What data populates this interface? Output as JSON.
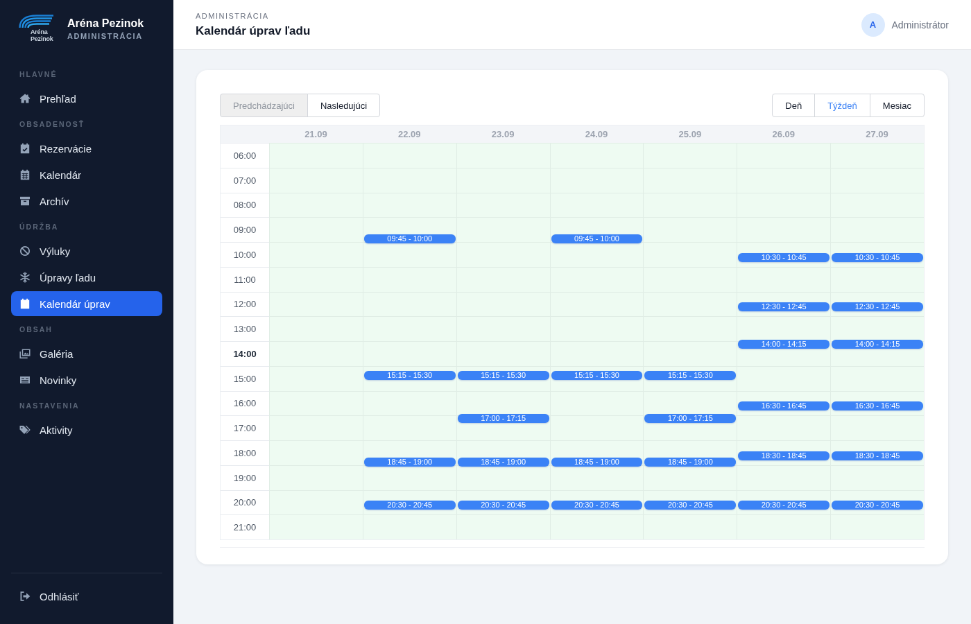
{
  "sidebar": {
    "brand": {
      "logo_text": "Aréna Pezinok",
      "name": "Aréna Pezinok",
      "subtitle": "ADMINISTRÁCIA"
    },
    "sections": [
      {
        "label": "HLAVNÉ",
        "items": [
          {
            "label": "Prehľad",
            "selected": false
          }
        ]
      },
      {
        "label": "OBSADENOSŤ",
        "items": [
          {
            "label": "Rezervácie",
            "selected": false
          },
          {
            "label": "Kalendár",
            "selected": false
          },
          {
            "label": "Archív",
            "selected": false
          }
        ]
      },
      {
        "label": "ÚDRŽBA",
        "items": [
          {
            "label": "Výluky",
            "selected": false
          },
          {
            "label": "Úpravy ľadu",
            "selected": false
          },
          {
            "label": "Kalendár úprav",
            "selected": true
          }
        ]
      },
      {
        "label": "OBSAH",
        "items": [
          {
            "label": "Galéria",
            "selected": false
          },
          {
            "label": "Novinky",
            "selected": false
          }
        ]
      },
      {
        "label": "NASTAVENIA",
        "items": [
          {
            "label": "Aktivity",
            "selected": false
          }
        ]
      }
    ],
    "logout": {
      "label": "Odhlásiť"
    }
  },
  "header": {
    "eyebrow": "ADMINISTRÁCIA",
    "title": "Kalendár úprav ľadu",
    "user": {
      "initial": "A",
      "name": "Administrátor"
    }
  },
  "toolbar": {
    "navigation": [
      {
        "label": "Predchádzajúci",
        "disabled": true
      },
      {
        "label": "Nasledujúci",
        "disabled": false
      }
    ],
    "views": [
      {
        "label": "Deň",
        "selected": false
      },
      {
        "label": "Týždeň",
        "selected": true
      },
      {
        "label": "Mesiac",
        "selected": false
      }
    ]
  },
  "calendar": {
    "times": [
      {
        "label": "06:00",
        "current": false
      },
      {
        "label": "07:00",
        "current": false
      },
      {
        "label": "08:00",
        "current": false
      },
      {
        "label": "09:00",
        "current": false
      },
      {
        "label": "10:00",
        "current": false
      },
      {
        "label": "11:00",
        "current": false
      },
      {
        "label": "12:00",
        "current": false
      },
      {
        "label": "13:00",
        "current": false
      },
      {
        "label": "14:00",
        "current": true
      },
      {
        "label": "15:00",
        "current": false
      },
      {
        "label": "16:00",
        "current": false
      },
      {
        "label": "17:00",
        "current": false
      },
      {
        "label": "18:00",
        "current": false
      },
      {
        "label": "19:00",
        "current": false
      },
      {
        "label": "20:00",
        "current": false
      },
      {
        "label": "21:00",
        "current": false
      }
    ],
    "days": [
      {
        "label": "21.09"
      },
      {
        "label": "22.09",
        "events": [
          "09:45 - 10:00",
          "15:15 - 15:30",
          "18:45 - 19:00",
          "20:30 - 20:45"
        ]
      },
      {
        "label": "23.09",
        "events": [
          "15:15 - 15:30",
          "17:00 - 17:15",
          "18:45 - 19:00",
          "20:30 - 20:45"
        ]
      },
      {
        "label": "24.09",
        "events": [
          "09:45 - 10:00",
          "15:15 - 15:30",
          "18:45 - 19:00",
          "20:30 - 20:45"
        ]
      },
      {
        "label": "25.09",
        "events": [
          "15:15 - 15:30",
          "17:00 - 17:15",
          "18:45 - 19:00",
          "20:30 - 20:45"
        ]
      },
      {
        "label": "26.09",
        "events": [
          "10:30 - 10:45",
          "12:30 - 12:45",
          "14:00 - 14:15",
          "16:30 - 16:45",
          "18:30 - 18:45",
          "20:30 - 20:45"
        ]
      },
      {
        "label": "27.09",
        "events": [
          "10:30 - 10:45",
          "12:30 - 12:45",
          "14:00 - 14:15",
          "16:30 - 16:45",
          "18:30 - 18:45",
          "20:30 - 20:45"
        ]
      }
    ]
  }
}
